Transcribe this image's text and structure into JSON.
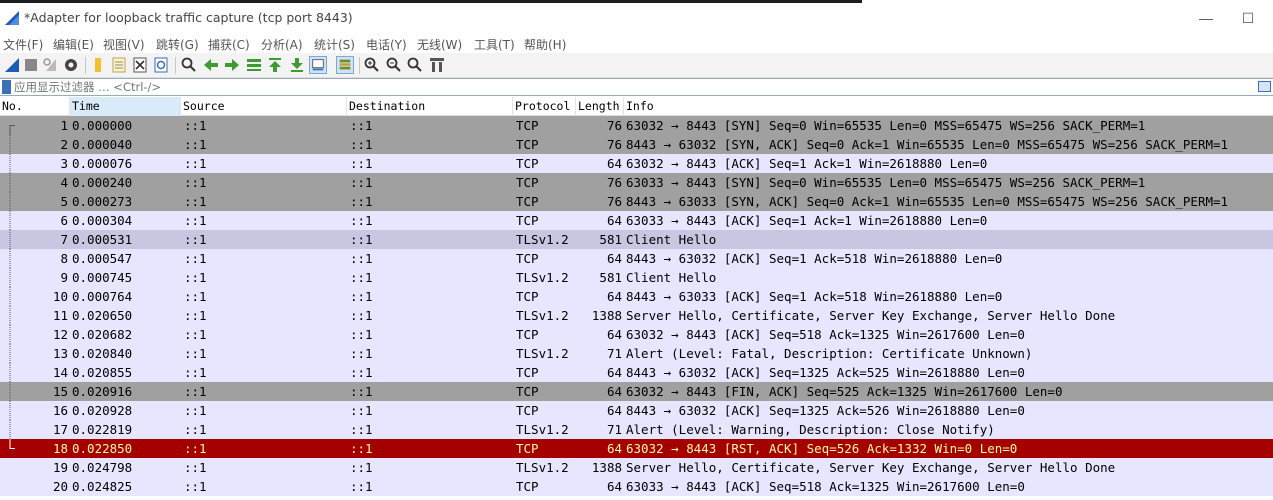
{
  "window": {
    "title": "*Adapter for loopback traffic capture (tcp port 8443)",
    "minimize_glyph": "—",
    "maximize_glyph": "☐"
  },
  "menu": [
    "文件(F)",
    "编辑(E)",
    "视图(V)",
    "跳转(G)",
    "捕获(C)",
    "分析(A)",
    "统计(S)",
    "电话(Y)",
    "无线(W)",
    "工具(T)",
    "帮助(H)"
  ],
  "toolbar_icons": [
    "shark-fin-icon",
    "stop-icon",
    "restart-icon",
    "options-icon",
    "open-folder-icon",
    "file-icon",
    "close-file-icon",
    "reload-icon",
    "find-icon",
    "back-arrow-icon",
    "forward-arrow-icon",
    "goto-packet-icon",
    "first-packet-icon",
    "last-packet-icon",
    "autoscroll-icon",
    "colorize-icon",
    "zoom-in-icon",
    "zoom-out-icon",
    "zoom-reset-icon",
    "resize-columns-icon"
  ],
  "filter": {
    "placeholder": "应用显示过滤器 … <Ctrl-/>"
  },
  "columns": [
    "No.",
    "Time",
    "Source",
    "Destination",
    "Protocol",
    "Length",
    "Info"
  ],
  "colors": {
    "gray": "#a0a0a0",
    "lavender": "#e7e6ff",
    "tls": "#c8c6e0",
    "red": "#a40000",
    "red_text": "#fffc9c"
  },
  "packets": [
    {
      "no": "1",
      "time": "0.000000",
      "src": "::1",
      "dst": "::1",
      "proto": "TCP",
      "len": "76",
      "info": "63032 → 8443 [SYN] Seq=0 Win=65535 Len=0 MSS=65475 WS=256 SACK_PERM=1",
      "style": "gray"
    },
    {
      "no": "2",
      "time": "0.000040",
      "src": "::1",
      "dst": "::1",
      "proto": "TCP",
      "len": "76",
      "info": "8443 → 63032 [SYN, ACK] Seq=0 Ack=1 Win=65535 Len=0 MSS=65475 WS=256 SACK_PERM=1",
      "style": "gray"
    },
    {
      "no": "3",
      "time": "0.000076",
      "src": "::1",
      "dst": "::1",
      "proto": "TCP",
      "len": "64",
      "info": "63032 → 8443 [ACK] Seq=1 Ack=1 Win=2618880 Len=0",
      "style": "lavender"
    },
    {
      "no": "4",
      "time": "0.000240",
      "src": "::1",
      "dst": "::1",
      "proto": "TCP",
      "len": "76",
      "info": "63033 → 8443 [SYN] Seq=0 Win=65535 Len=0 MSS=65475 WS=256 SACK_PERM=1",
      "style": "gray"
    },
    {
      "no": "5",
      "time": "0.000273",
      "src": "::1",
      "dst": "::1",
      "proto": "TCP",
      "len": "76",
      "info": "8443 → 63033 [SYN, ACK] Seq=0 Ack=1 Win=65535 Len=0 MSS=65475 WS=256 SACK_PERM=1",
      "style": "gray"
    },
    {
      "no": "6",
      "time": "0.000304",
      "src": "::1",
      "dst": "::1",
      "proto": "TCP",
      "len": "64",
      "info": "63033 → 8443 [ACK] Seq=1 Ack=1 Win=2618880 Len=0",
      "style": "lavender"
    },
    {
      "no": "7",
      "time": "0.000531",
      "src": "::1",
      "dst": "::1",
      "proto": "TLSv1.2",
      "len": "581",
      "info": "Client Hello",
      "style": "tls"
    },
    {
      "no": "8",
      "time": "0.000547",
      "src": "::1",
      "dst": "::1",
      "proto": "TCP",
      "len": "64",
      "info": "8443 → 63032 [ACK] Seq=1 Ack=518 Win=2618880 Len=0",
      "style": "lavender"
    },
    {
      "no": "9",
      "time": "0.000745",
      "src": "::1",
      "dst": "::1",
      "proto": "TLSv1.2",
      "len": "581",
      "info": "Client Hello",
      "style": "lavender"
    },
    {
      "no": "10",
      "time": "0.000764",
      "src": "::1",
      "dst": "::1",
      "proto": "TCP",
      "len": "64",
      "info": "8443 → 63033 [ACK] Seq=1 Ack=518 Win=2618880 Len=0",
      "style": "lavender"
    },
    {
      "no": "11",
      "time": "0.020650",
      "src": "::1",
      "dst": "::1",
      "proto": "TLSv1.2",
      "len": "1388",
      "info": "Server Hello, Certificate, Server Key Exchange, Server Hello Done",
      "style": "lavender"
    },
    {
      "no": "12",
      "time": "0.020682",
      "src": "::1",
      "dst": "::1",
      "proto": "TCP",
      "len": "64",
      "info": "63032 → 8443 [ACK] Seq=518 Ack=1325 Win=2617600 Len=0",
      "style": "lavender"
    },
    {
      "no": "13",
      "time": "0.020840",
      "src": "::1",
      "dst": "::1",
      "proto": "TLSv1.2",
      "len": "71",
      "info": "Alert (Level: Fatal, Description: Certificate Unknown)",
      "style": "lavender"
    },
    {
      "no": "14",
      "time": "0.020855",
      "src": "::1",
      "dst": "::1",
      "proto": "TCP",
      "len": "64",
      "info": "8443 → 63032 [ACK] Seq=1325 Ack=525 Win=2618880 Len=0",
      "style": "lavender"
    },
    {
      "no": "15",
      "time": "0.020916",
      "src": "::1",
      "dst": "::1",
      "proto": "TCP",
      "len": "64",
      "info": "63032 → 8443 [FIN, ACK] Seq=525 Ack=1325 Win=2617600 Len=0",
      "style": "gray"
    },
    {
      "no": "16",
      "time": "0.020928",
      "src": "::1",
      "dst": "::1",
      "proto": "TCP",
      "len": "64",
      "info": "8443 → 63032 [ACK] Seq=1325 Ack=526 Win=2618880 Len=0",
      "style": "lavender"
    },
    {
      "no": "17",
      "time": "0.022819",
      "src": "::1",
      "dst": "::1",
      "proto": "TLSv1.2",
      "len": "71",
      "info": "Alert (Level: Warning, Description: Close Notify)",
      "style": "lavender"
    },
    {
      "no": "18",
      "time": "0.022850",
      "src": "::1",
      "dst": "::1",
      "proto": "TCP",
      "len": "64",
      "info": "63032 → 8443 [RST, ACK] Seq=526 Ack=1332 Win=0 Len=0",
      "style": "red"
    },
    {
      "no": "19",
      "time": "0.024798",
      "src": "::1",
      "dst": "::1",
      "proto": "TLSv1.2",
      "len": "1388",
      "info": "Server Hello, Certificate, Server Key Exchange, Server Hello Done",
      "style": "lavender"
    },
    {
      "no": "20",
      "time": "0.024825",
      "src": "::1",
      "dst": "::1",
      "proto": "TCP",
      "len": "64",
      "info": "63033 → 8443 [ACK] Seq=518 Ack=1325 Win=2617600 Len=0",
      "style": "lavender"
    }
  ]
}
